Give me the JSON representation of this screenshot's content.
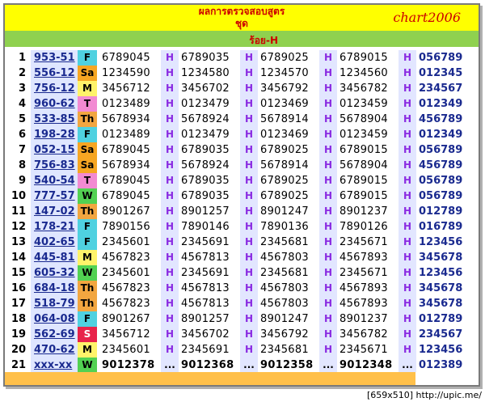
{
  "header": {
    "title_line1": "ผลการตรวจสอบสูตร",
    "title_line2": "ชุด",
    "brand": "chart2006",
    "sub_label": "ร้อย-H"
  },
  "day_colors": {
    "F": "#4fd1e0",
    "Sa": "#f6a623",
    "M": "#fff36a",
    "T": "#f28ad2",
    "Th": "#f2a640",
    "W": "#52d152",
    "S": "#e8234a"
  },
  "rows": [
    {
      "idx": "1",
      "code": "953-51",
      "day": "F",
      "n1": "6789045",
      "h1": "H",
      "n2": "6789035",
      "h2": "H",
      "n3": "6789025",
      "h3": "H",
      "n4": "6789015",
      "h4": "H",
      "res": "056789"
    },
    {
      "idx": "2",
      "code": "556-12",
      "day": "Sa",
      "n1": "1234590",
      "h1": "H",
      "n2": "1234580",
      "h2": "H",
      "n3": "1234570",
      "h3": "H",
      "n4": "1234560",
      "h4": "H",
      "res": "012345"
    },
    {
      "idx": "3",
      "code": "756-12",
      "day": "M",
      "n1": "3456712",
      "h1": "H",
      "n2": "3456702",
      "h2": "H",
      "n3": "3456792",
      "h3": "H",
      "n4": "3456782",
      "h4": "H",
      "res": "234567"
    },
    {
      "idx": "4",
      "code": "960-62",
      "day": "T",
      "n1": "0123489",
      "h1": "H",
      "n2": "0123479",
      "h2": "H",
      "n3": "0123469",
      "h3": "H",
      "n4": "0123459",
      "h4": "H",
      "res": "012349"
    },
    {
      "idx": "5",
      "code": "533-85",
      "day": "Th",
      "n1": "5678934",
      "h1": "H",
      "n2": "5678924",
      "h2": "H",
      "n3": "5678914",
      "h3": "H",
      "n4": "5678904",
      "h4": "H",
      "res": "456789"
    },
    {
      "idx": "6",
      "code": "198-28",
      "day": "F",
      "n1": "0123489",
      "h1": "H",
      "n2": "0123479",
      "h2": "H",
      "n3": "0123469",
      "h3": "H",
      "n4": "0123459",
      "h4": "H",
      "res": "012349"
    },
    {
      "idx": "7",
      "code": "052-15",
      "day": "Sa",
      "n1": "6789045",
      "h1": "H",
      "n2": "6789035",
      "h2": "H",
      "n3": "6789025",
      "h3": "H",
      "n4": "6789015",
      "h4": "H",
      "res": "056789"
    },
    {
      "idx": "8",
      "code": "756-83",
      "day": "Sa",
      "n1": "5678934",
      "h1": "H",
      "n2": "5678924",
      "h2": "H",
      "n3": "5678914",
      "h3": "H",
      "n4": "5678904",
      "h4": "H",
      "res": "456789"
    },
    {
      "idx": "9",
      "code": "540-54",
      "day": "T",
      "n1": "6789045",
      "h1": "H",
      "n2": "6789035",
      "h2": "H",
      "n3": "6789025",
      "h3": "H",
      "n4": "6789015",
      "h4": "H",
      "res": "056789"
    },
    {
      "idx": "10",
      "code": "777-57",
      "day": "W",
      "n1": "6789045",
      "h1": "H",
      "n2": "6789035",
      "h2": "H",
      "n3": "6789025",
      "h3": "H",
      "n4": "6789015",
      "h4": "H",
      "res": "056789"
    },
    {
      "idx": "11",
      "code": "147-02",
      "day": "Th",
      "n1": "8901267",
      "h1": "H",
      "n2": "8901257",
      "h2": "H",
      "n3": "8901247",
      "h3": "H",
      "n4": "8901237",
      "h4": "H",
      "res": "012789"
    },
    {
      "idx": "12",
      "code": "178-21",
      "day": "F",
      "n1": "7890156",
      "h1": "H",
      "n2": "7890146",
      "h2": "H",
      "n3": "7890136",
      "h3": "H",
      "n4": "7890126",
      "h4": "H",
      "res": "016789"
    },
    {
      "idx": "13",
      "code": "402-65",
      "day": "F",
      "n1": "2345601",
      "h1": "H",
      "n2": "2345691",
      "h2": "H",
      "n3": "2345681",
      "h3": "H",
      "n4": "2345671",
      "h4": "H",
      "res": "123456"
    },
    {
      "idx": "14",
      "code": "445-81",
      "day": "M",
      "n1": "4567823",
      "h1": "H",
      "n2": "4567813",
      "h2": "H",
      "n3": "4567803",
      "h3": "H",
      "n4": "4567893",
      "h4": "H",
      "res": "345678"
    },
    {
      "idx": "15",
      "code": "605-32",
      "day": "W",
      "n1": "2345601",
      "h1": "H",
      "n2": "2345691",
      "h2": "H",
      "n3": "2345681",
      "h3": "H",
      "n4": "2345671",
      "h4": "H",
      "res": "123456"
    },
    {
      "idx": "16",
      "code": "684-18",
      "day": "Th",
      "n1": "4567823",
      "h1": "H",
      "n2": "4567813",
      "h2": "H",
      "n3": "4567803",
      "h3": "H",
      "n4": "4567893",
      "h4": "H",
      "res": "345678"
    },
    {
      "idx": "17",
      "code": "518-79",
      "day": "Th",
      "n1": "4567823",
      "h1": "H",
      "n2": "4567813",
      "h2": "H",
      "n3": "4567803",
      "h3": "H",
      "n4": "4567893",
      "h4": "H",
      "res": "345678"
    },
    {
      "idx": "18",
      "code": "064-08",
      "day": "F",
      "n1": "8901267",
      "h1": "H",
      "n2": "8901257",
      "h2": "H",
      "n3": "8901247",
      "h3": "H",
      "n4": "8901237",
      "h4": "H",
      "res": "012789"
    },
    {
      "idx": "19",
      "code": "562-69",
      "day": "S",
      "n1": "3456712",
      "h1": "H",
      "n2": "3456702",
      "h2": "H",
      "n3": "3456792",
      "h3": "H",
      "n4": "3456782",
      "h4": "H",
      "res": "234567"
    },
    {
      "idx": "20",
      "code": "470-62",
      "day": "M",
      "n1": "2345601",
      "h1": "H",
      "n2": "2345691",
      "h2": "H",
      "n3": "2345681",
      "h3": "H",
      "n4": "2345671",
      "h4": "H",
      "res": "123456"
    },
    {
      "idx": "21",
      "code": "xxx-xx",
      "day": "W",
      "n1": "9012378",
      "h1": "...",
      "n2": "9012368",
      "h2": "...",
      "n3": "9012358",
      "h3": "...",
      "n4": "9012348",
      "h4": "...",
      "res": "012389"
    }
  ],
  "credit": "[659x510] http://upic.me/"
}
